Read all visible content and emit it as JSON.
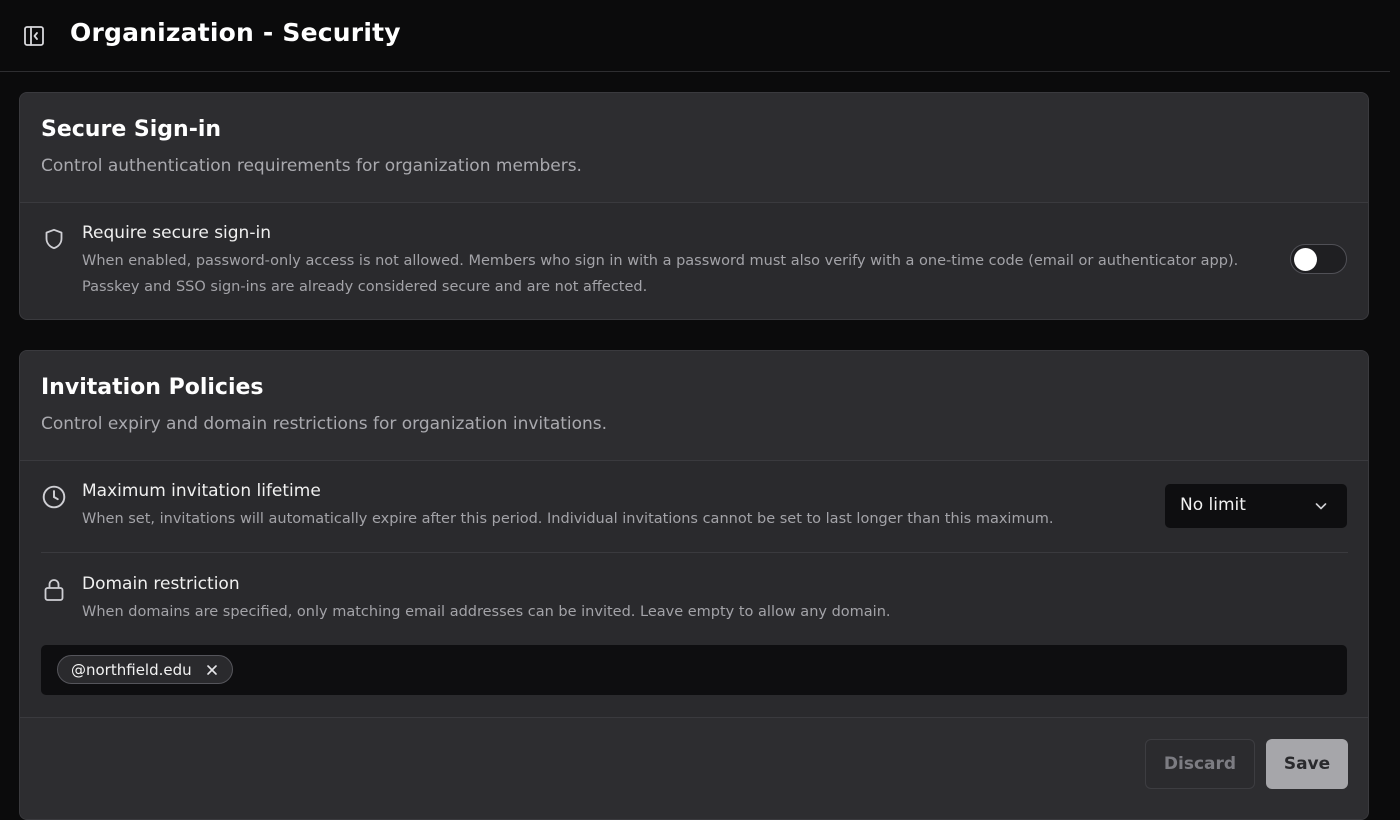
{
  "header": {
    "title": "Organization - Security"
  },
  "secure_signin": {
    "title": "Secure Sign-in",
    "subtitle": "Control authentication requirements for organization members.",
    "setting": {
      "label": "Require secure sign-in",
      "description_line1": "When enabled, password-only access is not allowed. Members who sign in with a password must also verify with a one-time code (email or authenticator app).",
      "description_line2": "Passkey and SSO sign-ins are already considered secure and are not affected.",
      "enabled": false
    }
  },
  "invitation_policies": {
    "title": "Invitation Policies",
    "subtitle": "Control expiry and domain restrictions for organization invitations.",
    "lifetime": {
      "label": "Maximum invitation lifetime",
      "description": "When set, invitations will automatically expire after this period. Individual invitations cannot be set to last longer than this maximum.",
      "selected": "No limit"
    },
    "domain": {
      "label": "Domain restriction",
      "description": "When domains are specified, only matching email addresses can be invited. Leave empty to allow any domain.",
      "chips": [
        "@northfield.edu"
      ]
    }
  },
  "actions": {
    "discard_label": "Discard",
    "save_label": "Save"
  },
  "icons": {
    "sidebar_toggle": "sidebar-collapse-icon",
    "signin": "shield-icon",
    "lifetime": "clock-icon",
    "domain": "lock-icon",
    "select": "chevron-down-icon",
    "chip_remove": "close-icon"
  },
  "colors": {
    "background": "#0b0b0c",
    "card": "#2a2a2d",
    "save_button": "#a6a6aa"
  }
}
